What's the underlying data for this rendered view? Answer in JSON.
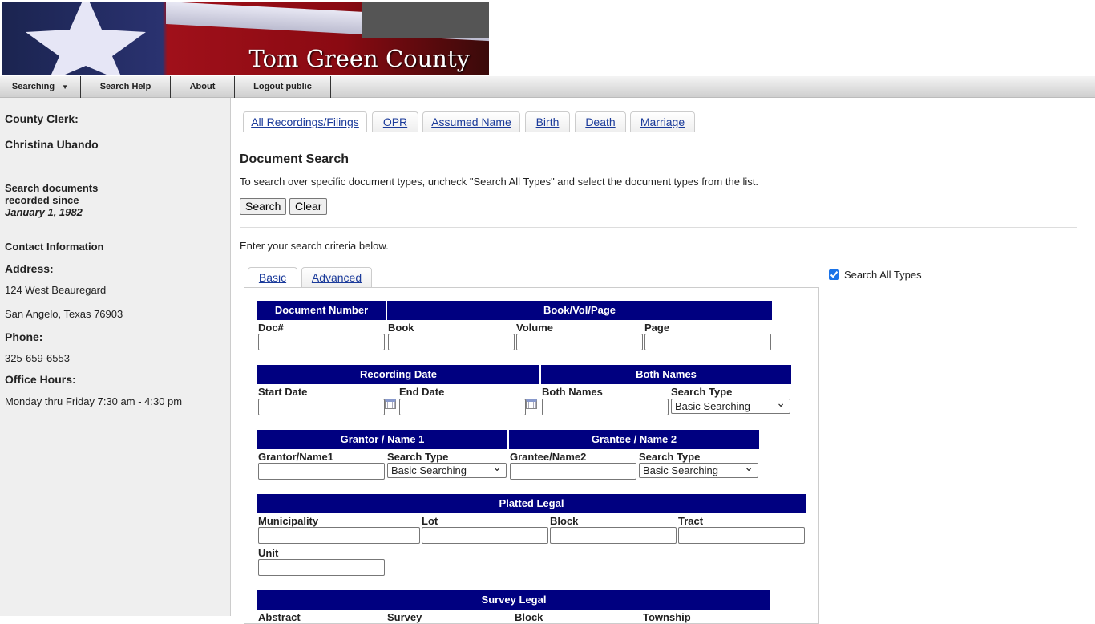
{
  "header": {
    "title": "Tom Green County"
  },
  "nav": [
    {
      "label": "Searching"
    },
    {
      "label": "Search Help"
    },
    {
      "label": "About"
    },
    {
      "label": "Logout public"
    }
  ],
  "sidebar": {
    "clerk_label": "County Clerk:",
    "clerk_name": "Christina Ubando",
    "since_line1": "Search documents",
    "since_line2": "recorded since",
    "since_date": "January 1, 1982",
    "contact": "Contact Information",
    "address_label": "Address:",
    "address1": "124 West Beauregard",
    "address2": "San Angelo, Texas 76903",
    "phone_label": "Phone:",
    "phone": "325-659-6553",
    "hours_label": "Office Hours:",
    "hours": "Monday thru Friday 7:30 am - 4:30 pm"
  },
  "tabs": [
    {
      "label": "All Recordings/Filings"
    },
    {
      "label": "OPR"
    },
    {
      "label": "Assumed Name"
    },
    {
      "label": "Birth"
    },
    {
      "label": "Death"
    },
    {
      "label": "Marriage"
    }
  ],
  "main": {
    "title": "Document Search",
    "instructions": "To search over specific document types, uncheck \"Search All Types\" and select the document types from the list.",
    "search_button": "Search",
    "clear_button": "Clear",
    "criteria": "Enter your search criteria below.",
    "search_all_types": "Search All Types",
    "search_all_checked": true
  },
  "subtabs": [
    {
      "label": "Basic"
    },
    {
      "label": "Advanced"
    }
  ],
  "form": {
    "doc_number": "Document Number",
    "doc_label": "Doc#",
    "bvp": "Book/Vol/Page",
    "book": "Book",
    "volume": "Volume",
    "page": "Page",
    "recording_date": "Recording Date",
    "start_date": "Start Date",
    "end_date": "End Date",
    "both_names": "Both Names",
    "both_names_label": "Both Names",
    "search_type": "Search Type",
    "basic_searching": "Basic Searching",
    "grantor": "Grantor / Name 1",
    "grantor_label": "Grantor/Name1",
    "grantee": "Grantee / Name 2",
    "grantee_label": "Grantee/Name2",
    "platted": "Platted Legal",
    "municipality": "Municipality",
    "lot": "Lot",
    "block": "Block",
    "tract": "Tract",
    "unit": "Unit",
    "survey_legal": "Survey Legal",
    "abstract": "Abstract",
    "survey": "Survey",
    "township": "Township"
  }
}
